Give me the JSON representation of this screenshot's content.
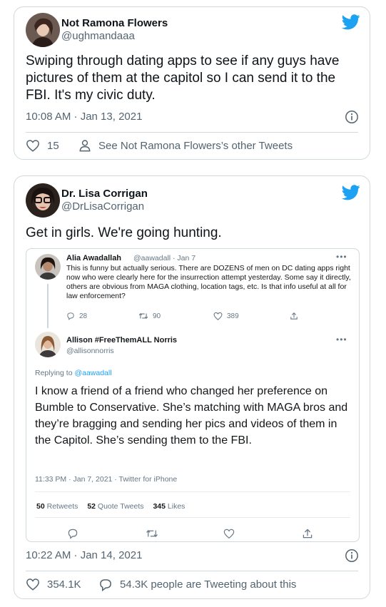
{
  "tweet1": {
    "name": "Not Ramona Flowers",
    "handle": "@ughmandaaa",
    "text": "Swiping through dating apps to see if any guys have pictures of them at the capitol so I can send it to the FBI.  It's my civic duty.",
    "timestamp": "10:08 AM · Jan 13, 2021",
    "likes": "15",
    "other_tweets": "See Not Ramona Flowers’s other Tweets"
  },
  "tweet2": {
    "name": "Dr. Lisa Corrigan",
    "handle": "@DrLisaCorrigan",
    "text": "Get in girls. We're going hunting.",
    "timestamp": "10:22 AM · Jan 14, 2021",
    "likes": "354.1K",
    "tweeting_about": "54.3K people are Tweeting about this"
  },
  "embedded": {
    "first": {
      "name": "Alia Awadallah",
      "handle_date": "@aawadall · Jan 7",
      "more": "•••",
      "text": "This is funny but actually serious. There are DOZENS of men on DC dating apps right now who were clearly here for the insurrection attempt yesterday. Some say it directly, others are obvious from MAGA clothing, location tags, etc. Is that info useful at all for law enforcement?",
      "replies": "28",
      "retweets": "90",
      "likes": "389"
    },
    "second": {
      "name": "Allison #FreeThemALL Norris",
      "handle": "@allisonnorris",
      "more": "•••",
      "replying_label": "Replying to",
      "replying_to": "@aawadall",
      "text": "I know a friend of a friend who changed her preference on Bumble to Conservative. She’s matching with MAGA bros and they’re bragging and sending her pics and videos of them in the Capitol. She’s sending them to the FBI.",
      "time": "11:33 PM · Jan 7, 2021 · Twitter for iPhone",
      "retweets_count": "50",
      "retweets_label": "Retweets",
      "quotes_count": "52",
      "quotes_label": "Quote Tweets",
      "likes_count": "345",
      "likes_label": "Likes"
    }
  },
  "colors": {
    "twitter_blue": "#1da1f2",
    "text": "#0f1419",
    "secondary": "#536471",
    "border": "#cfd9de"
  }
}
